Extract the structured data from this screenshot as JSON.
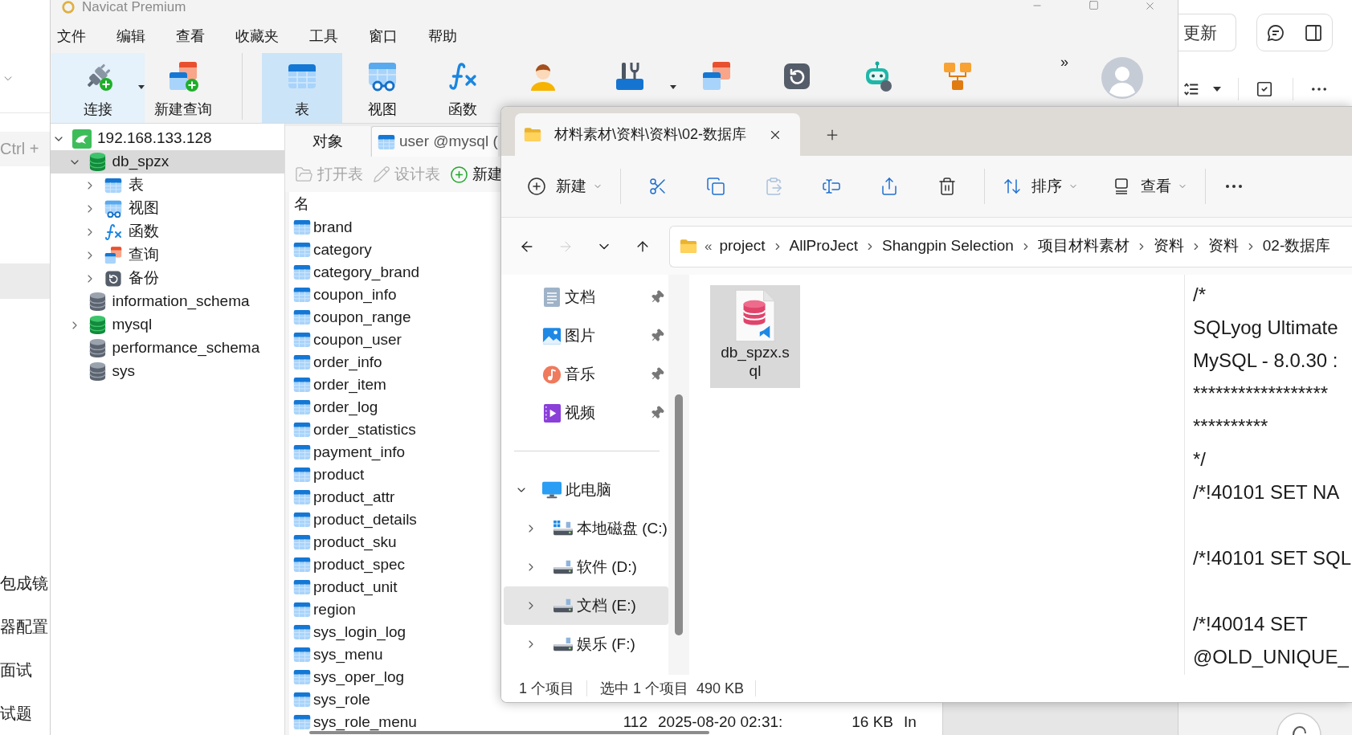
{
  "left_app": {
    "search": {
      "placeholder": "Ctrl +"
    },
    "highlight_band": true,
    "items": [
      "包成镜",
      "器配置",
      "面试",
      "试题"
    ]
  },
  "navicat": {
    "title": "Navicat Premium",
    "menu": [
      "文件",
      "编辑",
      "查看",
      "收藏夹",
      "工具",
      "窗口",
      "帮助"
    ],
    "toolbar": [
      [
        {
          "kind": "connection",
          "label": "连接",
          "dropdown": true,
          "selected": false,
          "hovered": true
        },
        {
          "kind": "new_query",
          "label": "新建查询",
          "dropdown": false,
          "selected": false,
          "hovered": false
        }
      ],
      [
        {
          "kind": "table",
          "label": "表",
          "dropdown": false,
          "selected": true,
          "hovered": false
        },
        {
          "kind": "view",
          "label": "视图",
          "dropdown": false,
          "selected": false,
          "hovered": false
        },
        {
          "kind": "function",
          "label": "函数",
          "dropdown": false,
          "selected": false,
          "hovered": false
        },
        {
          "kind": "user",
          "dropdown": false,
          "selected": false,
          "hovered": false
        },
        {
          "kind": "tools",
          "dropdown": true,
          "selected": false,
          "hovered": false
        },
        {
          "kind": "query",
          "dropdown": false,
          "selected": false,
          "hovered": false
        },
        {
          "kind": "backup",
          "dropdown": false,
          "selected": false,
          "hovered": false
        },
        {
          "kind": "automation",
          "dropdown": false,
          "selected": false,
          "hovered": false
        },
        {
          "kind": "model",
          "dropdown": false,
          "selected": false,
          "hovered": false
        }
      ]
    ],
    "overflow": "»",
    "tree": [
      {
        "kind": "connection",
        "label": "192.168.133.128",
        "expandable": true,
        "expanded": true,
        "selected": false,
        "children": [
          {
            "kind": "database",
            "label": "db_spzx",
            "open": true,
            "expandable": true,
            "expanded": true,
            "selected": true,
            "children": [
              {
                "kind": "tables",
                "label": "表",
                "expandable": true,
                "expanded": false,
                "selected": false
              },
              {
                "kind": "views",
                "label": "视图",
                "expandable": true,
                "expanded": false,
                "selected": false
              },
              {
                "kind": "functions",
                "label": "函数",
                "expandable": true,
                "expanded": false,
                "selected": false
              },
              {
                "kind": "queries",
                "label": "查询",
                "expandable": true,
                "expanded": false,
                "selected": false
              },
              {
                "kind": "backups",
                "label": "备份",
                "expandable": true,
                "expanded": false,
                "selected": false
              }
            ]
          },
          {
            "kind": "database",
            "label": "information_schema",
            "open": false,
            "expandable": false,
            "selected": false
          },
          {
            "kind": "database",
            "label": "mysql",
            "open": true,
            "expandable": true,
            "expanded": false,
            "selected": false
          },
          {
            "kind": "database",
            "label": "performance_schema",
            "open": false,
            "expandable": false,
            "selected": false
          },
          {
            "kind": "database",
            "label": "sys",
            "open": false,
            "expandable": false,
            "selected": false
          }
        ]
      }
    ],
    "tabs": [
      {
        "kind": "objects",
        "label": "对象",
        "selected": true
      },
      {
        "kind": "table",
        "label": "user @mysql (",
        "selected": false
      }
    ],
    "object_toolbar": [
      {
        "kind": "open",
        "label": "打开表",
        "disabled": true
      },
      {
        "kind": "design",
        "label": "设计表",
        "disabled": true
      },
      {
        "kind": "new",
        "label": "新建",
        "disabled": false
      }
    ],
    "object_list": {
      "header": "名",
      "rows": [
        {
          "name": "brand"
        },
        {
          "name": "category"
        },
        {
          "name": "category_brand"
        },
        {
          "name": "coupon_info"
        },
        {
          "name": "coupon_range"
        },
        {
          "name": "coupon_user"
        },
        {
          "name": "order_info"
        },
        {
          "name": "order_item"
        },
        {
          "name": "order_log"
        },
        {
          "name": "order_statistics"
        },
        {
          "name": "payment_info"
        },
        {
          "name": "product"
        },
        {
          "name": "product_attr"
        },
        {
          "name": "product_details"
        },
        {
          "name": "product_sku"
        },
        {
          "name": "product_spec"
        },
        {
          "name": "product_unit"
        },
        {
          "name": "region"
        },
        {
          "name": "sys_login_log"
        },
        {
          "name": "sys_menu"
        },
        {
          "name": "sys_oper_log"
        },
        {
          "name": "sys_role"
        },
        {
          "name": "sys_role_menu",
          "cells": [
            "112",
            "2025-08-20 02:31:",
            "16 KB",
            "In"
          ]
        }
      ]
    }
  },
  "explorer": {
    "tabs": [
      {
        "title": "材料素材\\资料\\资料\\02-数据库",
        "selected": true
      }
    ],
    "commands": [
      [
        {
          "kind": "new",
          "label": "新建",
          "dropdown": true,
          "disabled": false
        }
      ],
      [
        {
          "kind": "cut",
          "disabled": false
        },
        {
          "kind": "copy",
          "disabled": false
        },
        {
          "kind": "paste",
          "disabled": true
        },
        {
          "kind": "rename",
          "disabled": false
        },
        {
          "kind": "share",
          "disabled": false
        },
        {
          "kind": "delete",
          "disabled": false
        }
      ],
      [
        {
          "kind": "sort",
          "label": "排序",
          "dropdown": true,
          "disabled": false
        },
        {
          "kind": "view",
          "label": "查看",
          "dropdown": true,
          "disabled": false
        }
      ],
      [
        {
          "kind": "more",
          "disabled": false
        }
      ]
    ],
    "nav_buttons": [
      {
        "kind": "back",
        "disabled": false
      },
      {
        "kind": "forward",
        "disabled": true
      },
      {
        "kind": "recent",
        "disabled": false
      },
      {
        "kind": "up",
        "disabled": false
      }
    ],
    "address": {
      "overflow": "«",
      "crumbs": [
        "project",
        "AllProJect",
        "Shangpin Selection",
        "项目材料素材",
        "资料",
        "资料",
        "02-数据库"
      ]
    },
    "quick_access": [
      {
        "kind": "documents",
        "label": "文档",
        "pinned": true
      },
      {
        "kind": "pictures",
        "label": "图片",
        "pinned": true
      },
      {
        "kind": "music",
        "label": "音乐",
        "pinned": true
      },
      {
        "kind": "videos",
        "label": "视频",
        "pinned": true
      }
    ],
    "this_pc": {
      "label": "此电脑",
      "expanded": true,
      "drives": [
        {
          "kind": "system",
          "label": "本地磁盘 (C:)",
          "selected": false,
          "expanded": false
        },
        {
          "kind": "drive",
          "label": "软件 (D:)",
          "selected": false,
          "expanded": false
        },
        {
          "kind": "drive",
          "label": "文档 (E:)",
          "selected": true,
          "expanded": false
        },
        {
          "kind": "drive",
          "label": "娱乐 (F:)",
          "selected": false,
          "expanded": false
        }
      ]
    },
    "files": [
      {
        "kind": "sql",
        "name": "db_spzx.sql",
        "selected": true
      }
    ],
    "preview": {
      "blocks": [
        [
          "/*",
          "SQLyog Ultimate",
          "MySQL - 8.0.30 :",
          "******************",
          "**********",
          "*/",
          "/*!40101 SET NA"
        ],
        [
          "/*!40101 SET SQL"
        ],
        [
          "/*!40014 SET",
          "@OLD_UNIQUE_"
        ]
      ]
    },
    "status": {
      "count": "1 个项目",
      "selection": "选中 1 个项目",
      "size": "490 KB"
    }
  },
  "right_app": {
    "update_button": "更新"
  }
}
